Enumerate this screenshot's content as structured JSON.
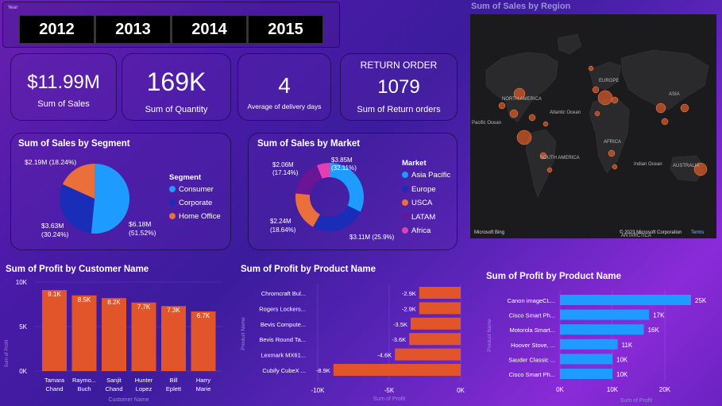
{
  "slicer": {
    "header": "Year",
    "years": [
      "2012",
      "2013",
      "2014",
      "2015"
    ]
  },
  "kpis": {
    "sales": {
      "value": "$11.99M",
      "label": "Sum of Sales"
    },
    "quantity": {
      "value": "169K",
      "label": "Sum of Quantity"
    },
    "delivery": {
      "value": "4",
      "label": "Average of delivery days"
    },
    "returns": {
      "heading": "RETURN ORDER",
      "value": "1079",
      "label": "Sum of Return orders"
    }
  },
  "map": {
    "title": "Sum of Sales by Region",
    "labels": {
      "north_america": "NORTH AMERICA",
      "europe": "EUROPE",
      "asia": "ASIA",
      "africa": "AFRICA",
      "south_america": "SOUTH AMERICA",
      "australia": "AUSTRALIA",
      "atlantic": "Atlantic Ocean",
      "pacific": "Pacific Ocean",
      "indian": "Indian Ocean",
      "pacific_left": "Pacific Ocean",
      "antarctica": "ANTARCTICA"
    },
    "attribution": "© 2023 Microsoft Corporation",
    "terms": "Terms",
    "bing": "Microsoft Bing"
  },
  "segment_chart": {
    "title": "Sum of Sales by Segment",
    "legend_title": "Segment",
    "colors": [
      "#1e9bff",
      "#1a2db8",
      "#ea6f3a"
    ],
    "labels": [
      "$6.18M",
      "(51.52%)",
      "$3.63M",
      "(30.24%)",
      "$2.19M (18.24%)"
    ]
  },
  "market_chart": {
    "title": "Sum of Sales by Market",
    "legend_title": "Market",
    "colors": [
      "#1e9bff",
      "#1a2db8",
      "#ea6f3a",
      "#6a1596",
      "#e040b0"
    ],
    "labels": [
      "$3.85M",
      "(32.11%)",
      "$3.11M (25.9%)",
      "$2.24M",
      "(18.64%)",
      "$2.06M",
      "(17.14%)"
    ]
  },
  "customer_chart": {
    "title": "Sum of Profit by Customer Name",
    "xlabel": "Customer Name",
    "ylabel": "Sum of Profit",
    "ticks": [
      "0K",
      "5K",
      "10K"
    ]
  },
  "product_neg_chart": {
    "title": "Sum of Profit by Product Name",
    "xlabel": "Sum of Profit",
    "ylabel": "Product Name",
    "ticks": [
      "-10K",
      "-5K",
      "0K"
    ]
  },
  "product_pos_chart": {
    "title": "Sum of Profit by Product Name",
    "xlabel": "Sum of Profit",
    "ylabel": "Product Name",
    "ticks": [
      "0K",
      "10K",
      "20K"
    ]
  },
  "chart_data": [
    {
      "type": "pie",
      "title": "Sum of Sales by Segment",
      "categories": [
        "Consumer",
        "Corporate",
        "Home Office"
      ],
      "values": [
        6.18,
        3.63,
        2.19
      ],
      "unit": "$M",
      "percents": [
        51.52,
        30.24,
        18.24
      ]
    },
    {
      "type": "pie",
      "subtype": "donut",
      "title": "Sum of Sales by Market",
      "categories": [
        "Asia Pacific",
        "Europe",
        "USCA",
        "LATAM",
        "Africa"
      ],
      "values": [
        3.85,
        3.11,
        2.24,
        2.06,
        0.73
      ],
      "unit": "$M",
      "percents": [
        32.11,
        25.9,
        18.64,
        17.14,
        6.1
      ]
    },
    {
      "type": "bar",
      "title": "Sum of Profit by Customer Name",
      "categories": [
        "Tamara Chand",
        "Raymond Buch",
        "Sanjit Chand",
        "Hunter Lopez",
        "Bill Eplett",
        "Harry Marie"
      ],
      "display_categories": [
        [
          "Tamara",
          "Chand"
        ],
        [
          "Raymo...",
          "Buch"
        ],
        [
          "Sanjit",
          "Chand"
        ],
        [
          "Hunter",
          "Lopez"
        ],
        [
          "Bill",
          "Eplett"
        ],
        [
          "Harry",
          "Marie"
        ]
      ],
      "values": [
        9.1,
        8.5,
        8.2,
        7.7,
        7.3,
        6.7
      ],
      "value_labels": [
        "9.1K",
        "8.5K",
        "8.2K",
        "7.7K",
        "7.3K",
        "6.7K"
      ],
      "unit": "K",
      "ylim": [
        0,
        10
      ],
      "color": "#e2552a"
    },
    {
      "type": "bar",
      "orientation": "horizontal",
      "title": "Sum of Profit by Product Name",
      "categories": [
        "Chromcraft Bul...",
        "Rogers Lockers...",
        "Bevis Compute...",
        "Bevis Round Ta...",
        "Lexmark MX61...",
        "Cubify CubeX ..."
      ],
      "values": [
        -2.9,
        -2.9,
        -3.5,
        -3.6,
        -4.6,
        -8.9
      ],
      "value_labels": [
        "-2.9K",
        "-2.9K",
        "-3.5K",
        "-3.6K",
        "-4.6K",
        "-8.9K"
      ],
      "unit": "K",
      "xlim": [
        -10,
        0
      ],
      "color": "#e2552a"
    },
    {
      "type": "bar",
      "orientation": "horizontal",
      "title": "Sum of Profit by Product Name",
      "categories": [
        "Canon imageCL...",
        "Cisco Smart Ph...",
        "Motorola Smart...",
        "Hoover Stove, ...",
        "Sauder Classic ...",
        "Cisco Smart Ph..."
      ],
      "values": [
        25,
        17,
        16,
        11,
        10,
        10
      ],
      "value_labels": [
        "25K",
        "17K",
        "16K",
        "11K",
        "10K",
        "10K"
      ],
      "unit": "K",
      "xlim": [
        0,
        25
      ],
      "color": "#1e9bff"
    }
  ]
}
